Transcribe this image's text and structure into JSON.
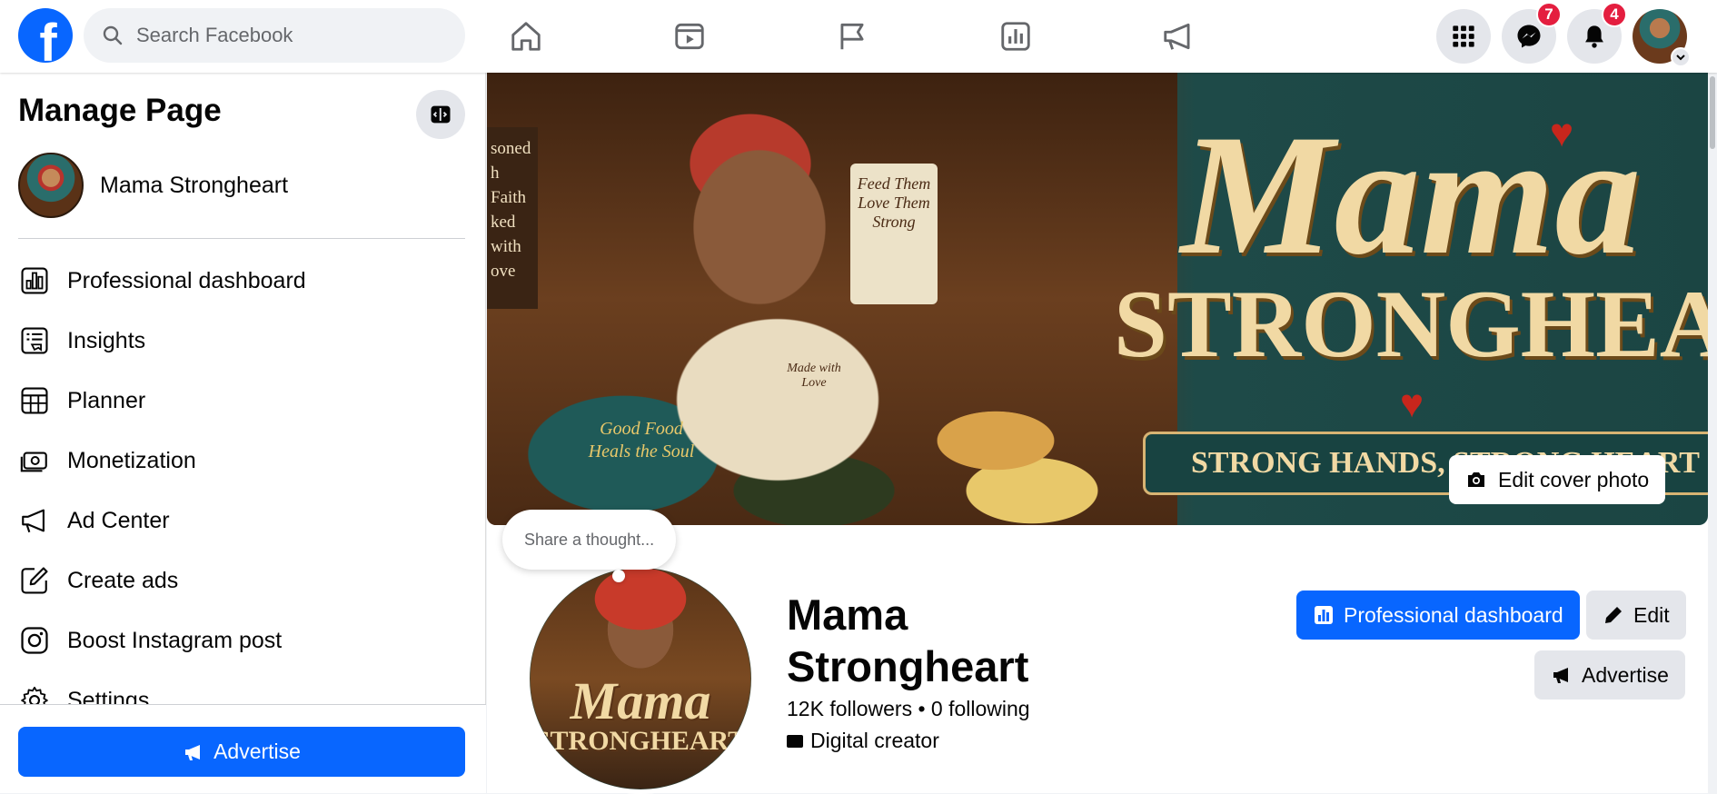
{
  "topbar": {
    "logo": "f",
    "search_placeholder": "Search Facebook",
    "nav_icons": [
      "home-icon",
      "video-icon",
      "flag-icon",
      "dashboard-icon",
      "megaphone-icon"
    ],
    "messenger_badge": "7",
    "notifications_badge": "4"
  },
  "sidebar": {
    "title": "Manage Page",
    "page_name": "Mama Strongheart",
    "items": [
      {
        "label": "Professional dashboard",
        "icon": "dashboard-icon"
      },
      {
        "label": "Insights",
        "icon": "insights-icon"
      },
      {
        "label": "Planner",
        "icon": "planner-icon"
      },
      {
        "label": "Monetization",
        "icon": "monetization-icon"
      },
      {
        "label": "Ad Center",
        "icon": "megaphone-icon"
      },
      {
        "label": "Create ads",
        "icon": "create-ads-icon"
      },
      {
        "label": "Boost Instagram post",
        "icon": "instagram-icon"
      },
      {
        "label": "Settings",
        "icon": "gear-icon"
      }
    ],
    "advertise_label": "Advertise"
  },
  "cover": {
    "left_sign": "soned\nh Faith\nked with\nove",
    "feed_sign": "Feed Them Love Them Strong",
    "pot_text": "Good Food Heals the Soul",
    "apron_text": "Made with Love",
    "title_script": "Mama",
    "title_block": "STRONGHEART",
    "tagline": "STRONG HANDS, STRONG HEART",
    "edit_cover_label": "Edit cover photo"
  },
  "profile": {
    "thought_placeholder": "Share a thought...",
    "pic_script": "Mama",
    "pic_block": "STRONGHEART",
    "name": "Mama Strongheart",
    "stats": "12K followers • 0 following",
    "category": "Digital creator",
    "buttons": {
      "professional_dashboard": "Professional dashboard",
      "edit": "Edit",
      "advertise": "Advertise"
    }
  },
  "colors": {
    "brand": "#0866ff",
    "badge": "#e41e3f",
    "button_gray": "#e4e6eb"
  }
}
